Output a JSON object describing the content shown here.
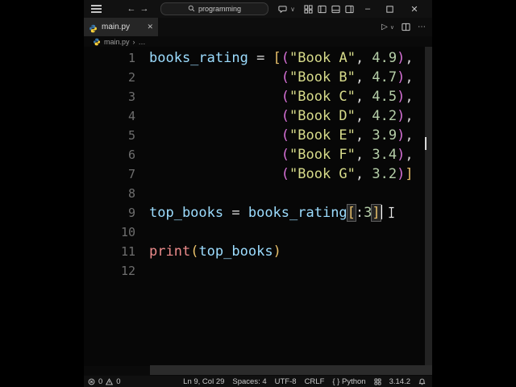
{
  "titlebar": {
    "search_text": "programming",
    "icons": [
      "menu",
      "back",
      "forward",
      "chat",
      "layout-grid",
      "layout-sidebar-left",
      "layout-panel",
      "layout-sidebar-right",
      "minimize",
      "maximize",
      "close"
    ]
  },
  "tab": {
    "label": "main.py",
    "close_glyph": "✕"
  },
  "tab_actions": {
    "run_glyph": "▷",
    "run_chevron": "∨",
    "more_glyph": "⋯"
  },
  "breadcrumb": {
    "file": "main.py",
    "separator": "›",
    "more": "…"
  },
  "editor": {
    "lines": [
      {
        "num": "1",
        "segs": [
          [
            "v",
            "books_rating"
          ],
          [
            "o",
            " = "
          ],
          [
            "g",
            "["
          ],
          [
            "m",
            "("
          ],
          [
            "s",
            "\"Book A\""
          ],
          [
            "o",
            ", "
          ],
          [
            "n",
            "4.9"
          ],
          [
            "m",
            ")"
          ],
          [
            "o",
            ","
          ]
        ]
      },
      {
        "num": "2",
        "segs": [
          [
            "o",
            "                "
          ],
          [
            "m",
            "("
          ],
          [
            "s",
            "\"Book B\""
          ],
          [
            "o",
            ", "
          ],
          [
            "n",
            "4.7"
          ],
          [
            "m",
            ")"
          ],
          [
            "o",
            ","
          ]
        ]
      },
      {
        "num": "3",
        "segs": [
          [
            "o",
            "                "
          ],
          [
            "m",
            "("
          ],
          [
            "s",
            "\"Book C\""
          ],
          [
            "o",
            ", "
          ],
          [
            "n",
            "4.5"
          ],
          [
            "m",
            ")"
          ],
          [
            "o",
            ","
          ]
        ]
      },
      {
        "num": "4",
        "segs": [
          [
            "o",
            "                "
          ],
          [
            "m",
            "("
          ],
          [
            "s",
            "\"Book D\""
          ],
          [
            "o",
            ", "
          ],
          [
            "n",
            "4.2"
          ],
          [
            "m",
            ")"
          ],
          [
            "o",
            ","
          ]
        ]
      },
      {
        "num": "5",
        "segs": [
          [
            "o",
            "                "
          ],
          [
            "m",
            "("
          ],
          [
            "s",
            "\"Book E\""
          ],
          [
            "o",
            ", "
          ],
          [
            "n",
            "3.9"
          ],
          [
            "m",
            ")"
          ],
          [
            "o",
            ","
          ]
        ]
      },
      {
        "num": "6",
        "segs": [
          [
            "o",
            "                "
          ],
          [
            "m",
            "("
          ],
          [
            "s",
            "\"Book F\""
          ],
          [
            "o",
            ", "
          ],
          [
            "n",
            "3.4"
          ],
          [
            "m",
            ")"
          ],
          [
            "o",
            ","
          ]
        ]
      },
      {
        "num": "7",
        "segs": [
          [
            "o",
            "                "
          ],
          [
            "m",
            "("
          ],
          [
            "s",
            "\"Book G\""
          ],
          [
            "o",
            ", "
          ],
          [
            "n",
            "3.2"
          ],
          [
            "m",
            ")"
          ],
          [
            "g",
            "]"
          ]
        ]
      },
      {
        "num": "8",
        "segs": []
      },
      {
        "num": "9",
        "cursor": true,
        "segs": [
          [
            "v",
            "top_books"
          ],
          [
            "o",
            " = "
          ],
          [
            "v",
            "books_rating"
          ],
          [
            "gx",
            "["
          ],
          [
            "o",
            ":"
          ],
          [
            "n",
            "3"
          ],
          [
            "gx",
            "]"
          ]
        ]
      },
      {
        "num": "10",
        "segs": []
      },
      {
        "num": "11",
        "segs": [
          [
            "f",
            "print"
          ],
          [
            "g",
            "("
          ],
          [
            "v",
            "top_books"
          ],
          [
            "g",
            ")"
          ]
        ]
      },
      {
        "num": "12",
        "segs": []
      }
    ]
  },
  "colors": {
    "variable": "#9cdcfe",
    "string": "#d7db8a",
    "number": "#b5cea8",
    "bracket_gold": "#e8c06a",
    "bracket_pink": "#d670d6",
    "function_call": "#ec8b8b",
    "plain": "#d4d4d4",
    "python_blue": "#3874a8",
    "python_yellow": "#ffd43b"
  },
  "statusbar": {
    "errors": "0",
    "warnings": "0",
    "segments": [
      "Ln 9, Col 29",
      "Spaces: 4",
      "UTF-8",
      "CRLF",
      "{ } Python"
    ],
    "version": "3.14.2"
  }
}
